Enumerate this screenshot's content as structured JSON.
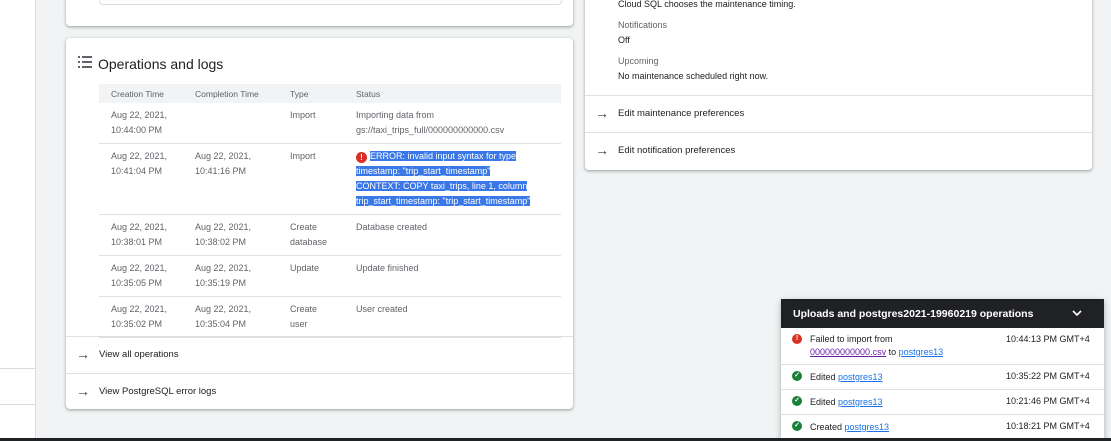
{
  "ops_card": {
    "title": "Operations and logs",
    "columns": [
      "Creation Time",
      "Completion Time",
      "Type",
      "Status"
    ],
    "rows": [
      {
        "creation": [
          "Aug 22, 2021,",
          "10:44:00 PM"
        ],
        "completion": [
          "",
          ""
        ],
        "type": [
          "Import",
          ""
        ],
        "status": [
          "Importing data from",
          "gs://taxi_trips_full/000000000000.csv"
        ]
      },
      {
        "creation": [
          "Aug 22, 2021,",
          "10:41:04 PM"
        ],
        "completion": [
          "Aug 22, 2021,",
          "10:41:16 PM"
        ],
        "type": [
          "Import",
          ""
        ],
        "status": [
          "ERROR: invalid input syntax for type",
          "timestamp: \"trip_start_timestamp\"",
          "CONTEXT: COPY taxi_trips, line 1, column",
          "trip_start_timestamp: \"trip_start_timestamp\""
        ]
      },
      {
        "creation": [
          "Aug 22, 2021,",
          "10:38:01 PM"
        ],
        "completion": [
          "Aug 22, 2021,",
          "10:38:02 PM"
        ],
        "type": [
          "Create",
          "database"
        ],
        "status": [
          "Database created"
        ]
      },
      {
        "creation": [
          "Aug 22, 2021,",
          "10:35:05 PM"
        ],
        "completion": [
          "Aug 22, 2021,",
          "10:35:19 PM"
        ],
        "type": [
          "Update",
          ""
        ],
        "status": [
          "Update finished"
        ]
      },
      {
        "creation": [
          "Aug 22, 2021,",
          "10:35:02 PM"
        ],
        "completion": [
          "Aug 22, 2021,",
          "10:35:04 PM"
        ],
        "type": [
          "Create",
          "user"
        ],
        "status": [
          "User created"
        ]
      }
    ],
    "view_all": "View all operations",
    "error_logs": "View PostgreSQL error logs"
  },
  "maintenance": {
    "timing_text": "Cloud SQL chooses the maintenance timing.",
    "notifications_label": "Notifications",
    "notifications_value": "Off",
    "upcoming_label": "Upcoming",
    "upcoming_value": "No maintenance scheduled right now.",
    "edit_maintenance": "Edit maintenance preferences",
    "edit_notifications": "Edit notification preferences"
  },
  "uploads_panel": {
    "title": "Uploads and postgres2021-19960219 operations",
    "items": [
      {
        "status": "error",
        "prefix": "Failed to import from",
        "file_link": "000000000000.csv",
        "middle": " to ",
        "target_link": "postgres13",
        "time": "10:44:13 PM GMT+4"
      },
      {
        "status": "ok",
        "prefix": "Edited ",
        "target_link": "postgres13",
        "time": "10:35:22 PM GMT+4"
      },
      {
        "status": "ok",
        "prefix": "Edited ",
        "target_link": "postgres13",
        "time": "10:21:46 PM GMT+4"
      },
      {
        "status": "ok",
        "prefix": "Created ",
        "target_link": "postgres13",
        "time": "10:18:21 PM GMT+4"
      }
    ]
  },
  "colors": {
    "accent": "#1a73e8",
    "error": "#d93025",
    "success": "#188038",
    "selection": "#3b78e7",
    "panel_header": "#202124"
  },
  "icons": {
    "list": "list-icon",
    "arrow": "arrow-right-icon",
    "chevron": "chevron-down-icon",
    "error": "error-circle-icon",
    "success": "check-circle-icon"
  }
}
